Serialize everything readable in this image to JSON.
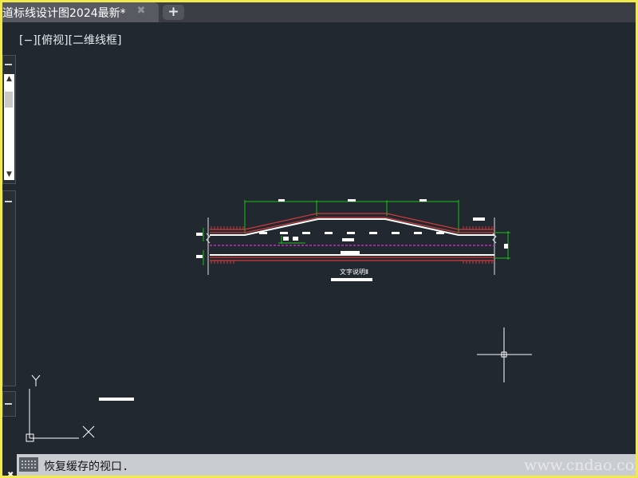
{
  "tab": {
    "title": "道标线设计图2024最新*",
    "close_glyph": "✖",
    "add_glyph": "+"
  },
  "viewport": {
    "label": "[−][俯视][二维线框]"
  },
  "drawing": {
    "caption": "文字说明Ⅱ"
  },
  "ucs": {
    "x_label": "X",
    "y_label": "Y"
  },
  "status": {
    "message": "恢复缓存的视口."
  },
  "watermark": "www.cndao.com",
  "colors": {
    "canvas": "#212830",
    "frame": "#f2e94a",
    "red_line": "#d23a3a",
    "green_dim": "#19c219",
    "magenta_line": "#c32bc3",
    "white_mark": "#ffffff"
  }
}
